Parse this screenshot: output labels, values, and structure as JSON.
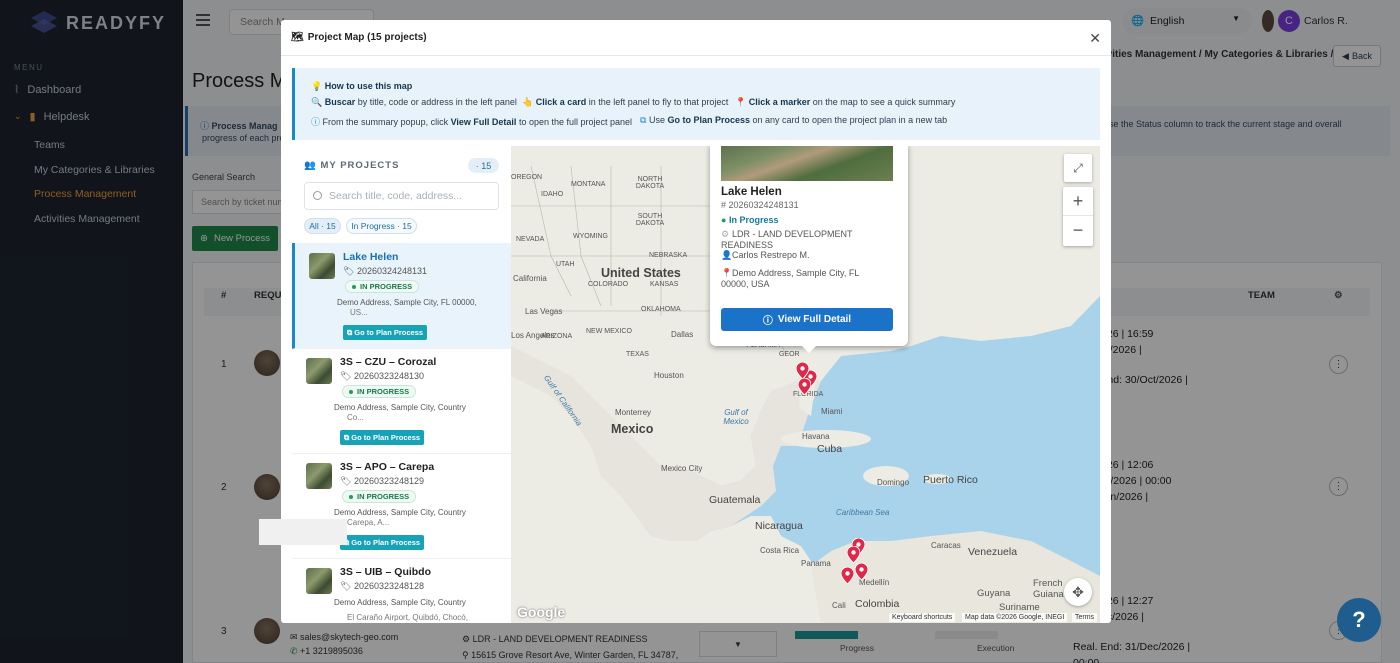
{
  "sidebar": {
    "brand": "READYFY",
    "menu_caption": "MENU",
    "dashboard": "Dashboard",
    "helpdesk": "Helpdesk",
    "subitems": [
      "Teams",
      "My Categories & Libraries",
      "Process Management",
      "Activities Management"
    ]
  },
  "topbar": {
    "search_placeholder": "Search M",
    "language": "English",
    "user_initial": "C",
    "user_name": "Carlos R."
  },
  "page": {
    "title": "Process Ma",
    "breadcrumb": "ctivities Management  /  My Categories & Libraries  /",
    "back": "Back",
    "info_label": "Process Manag",
    "info_tail": "ution. Use the Status column to track the current stage and overall",
    "info_line2": "progress of each pro",
    "general_search_label": "General Search",
    "general_search_placeholder": "Search by ticket num",
    "new_process": "New Process",
    "table_headers": {
      "num": "#",
      "req": "REQU",
      "team": "TEAM"
    },
    "rows": [
      {
        "num": "1",
        "dates": [
          "/Apr/2026 | 16:59",
          ": 30/Oct/2026 |",
          "",
          "Real. End: 30/Oct/2026 |"
        ]
      },
      {
        "num": "2",
        "dates": [
          "/Apr/2026 | 12:06",
          ": 30/Jun/2026 | 00:00",
          "d: 30/Jun/2026 |"
        ]
      },
      {
        "num": "3",
        "dates": [
          "/Apr/2026 | 12:27",
          ": 31/Dec/2026 |",
          "",
          "Real. End: 31/Dec/2026 |",
          "00:00"
        ]
      }
    ],
    "row3_email": "sales@skytech-geo.com",
    "row3_phone": "+1 3219895036",
    "row3_category": "LDR - LAND DEVELOPMENT READINESS",
    "row3_address": "15615 Grove Resort Ave, Winter Garden, FL 34787,",
    "row3_progress": "Progress",
    "row3_execution": "Execution"
  },
  "modal": {
    "title": "Project Map (15 projects)",
    "howto_title": "How to use this map",
    "howto": {
      "l1a_b": "Buscar",
      "l1a": " by title, code or address in the left panel",
      "l1b_b": "Click a card",
      "l1b": " in the left panel to fly to that project",
      "l1c_b": "Click a marker",
      "l1c": " on the map to see a quick summary",
      "l2a": "From the summary popup, click ",
      "l2a_b": "View Full Detail",
      "l2a2": " to open the full project panel",
      "l2b": "Use ",
      "l2b_b": "Go to Plan Process",
      "l2b2": " on any card to open the project plan in a new tab"
    },
    "panel_title": "MY PROJECTS",
    "panel_count": "· 15",
    "search_placeholder": "Search title, code, address...",
    "filter_all": "All · 15",
    "filter_inprogress": "In Progress · 15",
    "cards": [
      {
        "name": "Lake Helen",
        "code": "20260324248131",
        "status": "IN PROGRESS",
        "addr": "Demo Address, Sample City, FL 00000,",
        "addr2": "US...",
        "btn": "Go to Plan Process"
      },
      {
        "name": "3S – CZU – Corozal",
        "code": "20260323248130",
        "status": "IN PROGRESS",
        "addr": "Demo Address, Sample City, Country",
        "addr2": "Co...",
        "btn": "Go to Plan Process"
      },
      {
        "name": "3S – APO – Carepa",
        "code": "20260323248129",
        "status": "IN PROGRESS",
        "addr": "Demo Address, Sample City, Country",
        "addr2": "Carepa, A...",
        "btn": "Go to Plan Process"
      },
      {
        "name": "3S – UIB – Quibdo",
        "code": "20260323248128",
        "status": "IN PROGRESS",
        "addr": "Demo Address, Sample City, Country",
        "addr2": "El Caraño Airport, Quibdó, Chocó,",
        "btn": ""
      }
    ],
    "popup": {
      "title": "Lake Helen",
      "code": "# 20260324248131",
      "status": "In Progress",
      "category": "LDR - LAND DEVELOPMENT READINESS",
      "person": "Carlos Restrepo M.",
      "address": "Demo Address, Sample City, FL 00000, USA",
      "button": "View Full Detail"
    },
    "map_labels": {
      "united_states": "United States",
      "mexico": "Mexico",
      "cuba": "Cuba",
      "venezuela": "Venezuela",
      "colombia": "Colombia",
      "nicaragua": "Nicaragua",
      "guatemala": "Guatemala",
      "puerto_rico": "Puerto Rico",
      "gulf_mexico": "Gulf of Mexico",
      "gulf_california": "Gulf of California",
      "caribbean": "Caribbean Sea",
      "california": "California",
      "las_vegas": "Las Vegas",
      "los_angeles": "Los Angeles",
      "arizona": "ARIZONA",
      "new_mexico": "NEW MEXICO",
      "texas": "TEXAS",
      "dallas": "Dallas",
      "houston": "Houston",
      "colorado": "COLORADO",
      "kansas": "KANSAS",
      "oklahoma": "OKLAHOMA",
      "nebraska": "NEBRASKA",
      "utah": "UTAH",
      "nevada": "NEVADA",
      "idaho": "IDAHO",
      "wyoming": "WYOMING",
      "montana": "MONTANA",
      "n_dakota": "NORTH DAKOTA",
      "s_dakota": "SOUTH DAKOTA",
      "oregon": "OREGON",
      "florida": "FLORIDA",
      "miami": "Miami",
      "havana": "Havana",
      "monterrey": "Monterrey",
      "mexico_city": "Mexico City",
      "costa_rica": "Costa Rica",
      "panama": "Panama",
      "domingo": "Domingo",
      "caracas": "Caracas",
      "medellin": "Medellín",
      "cali": "Cali",
      "guyana": "Guyana",
      "suriname": "Suriname",
      "french_guiana": "French Guiana",
      "alabama": "ALABAMA",
      "georgia": "GEOR"
    },
    "attribution": {
      "shortcuts": "Keyboard shortcuts",
      "data": "Map data ©2026 Google, INEGI",
      "terms": "Terms",
      "google": "Google"
    }
  },
  "help": "?"
}
